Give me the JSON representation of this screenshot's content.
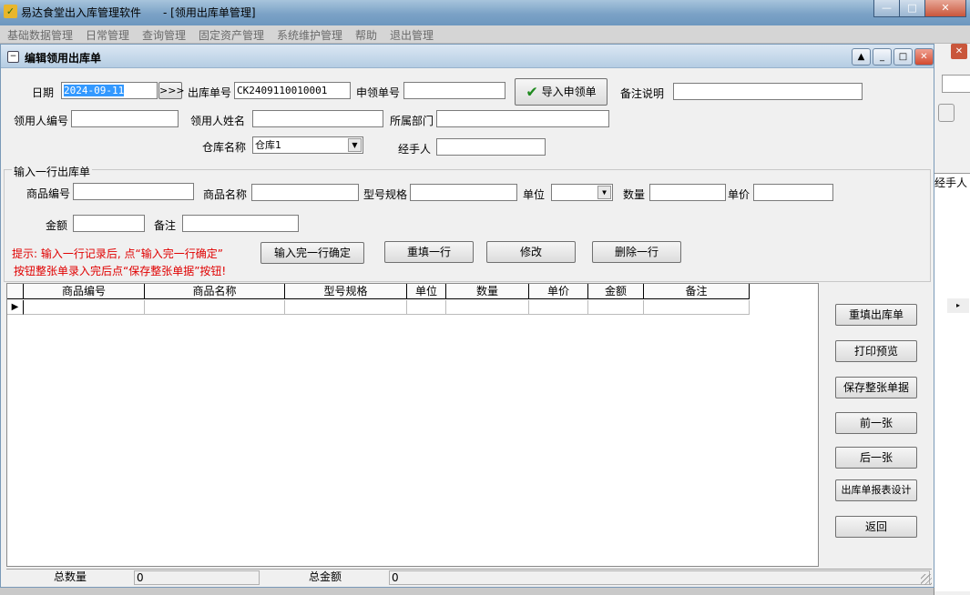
{
  "app": {
    "title": "易达食堂出入库管理软件　　- [领用出库单管理]",
    "window_buttons": [
      "—",
      "□",
      "✕"
    ]
  },
  "menu": [
    "基础数据管理",
    "日常管理",
    "查询管理",
    "固定资产管理",
    "系统维护管理",
    "帮助",
    "退出管理"
  ],
  "child": {
    "title": "编辑领用出库单"
  },
  "header_form": {
    "date_label": "日期",
    "date_value": "2024-09-11",
    "date_picker": ">>>",
    "out_no_label": "出库单号",
    "out_no_value": "CK2409110010001",
    "request_no_label": "申领单号",
    "request_no_value": "",
    "import_button": "导入申领单",
    "remark_label": "备注说明",
    "remark_value": "",
    "recipient_no_label": "领用人编号",
    "recipient_no_value": "",
    "recipient_name_label": "领用人姓名",
    "recipient_name_value": "",
    "department_label": "所属部门",
    "department_value": "",
    "warehouse_label": "仓库名称",
    "warehouse_value": "仓库1",
    "handler_label": "经手人",
    "handler_value": ""
  },
  "line_form": {
    "group_label": "输入一行出库单",
    "item_no_label": "商品编号",
    "item_name_label": "商品名称",
    "spec_label": "型号规格",
    "unit_label": "单位",
    "qty_label": "数量",
    "price_label": "单价",
    "amount_label": "金额",
    "note_label": "备注",
    "hint_line1": "提示: 输入一行记录后, 点“输入完一行确定”",
    "hint_line2": "按钮整张单录入完后点“保存整张单据”按钮!",
    "btn_confirm": "输入完一行确定",
    "btn_reset_line": "重填一行",
    "btn_edit": "修改",
    "btn_delete": "删除一行"
  },
  "grid": {
    "columns": [
      "商品编号",
      "商品名称",
      "型号规格",
      "单位",
      "数量",
      "单价",
      "金额",
      "备注"
    ],
    "row_marker": "▶"
  },
  "side_buttons": {
    "reset": "重填出库单",
    "print_preview": "打印预览",
    "save": "保存整张单据",
    "prev": "前一张",
    "next": "后一张",
    "report_design": "出库单报表设计",
    "back": "返回"
  },
  "status": {
    "total_qty_label": "总数量",
    "total_qty_value": "0",
    "total_amount_label": "总金额",
    "total_amount_value": "0"
  },
  "background_window": {
    "column_fragment": "经手人"
  }
}
